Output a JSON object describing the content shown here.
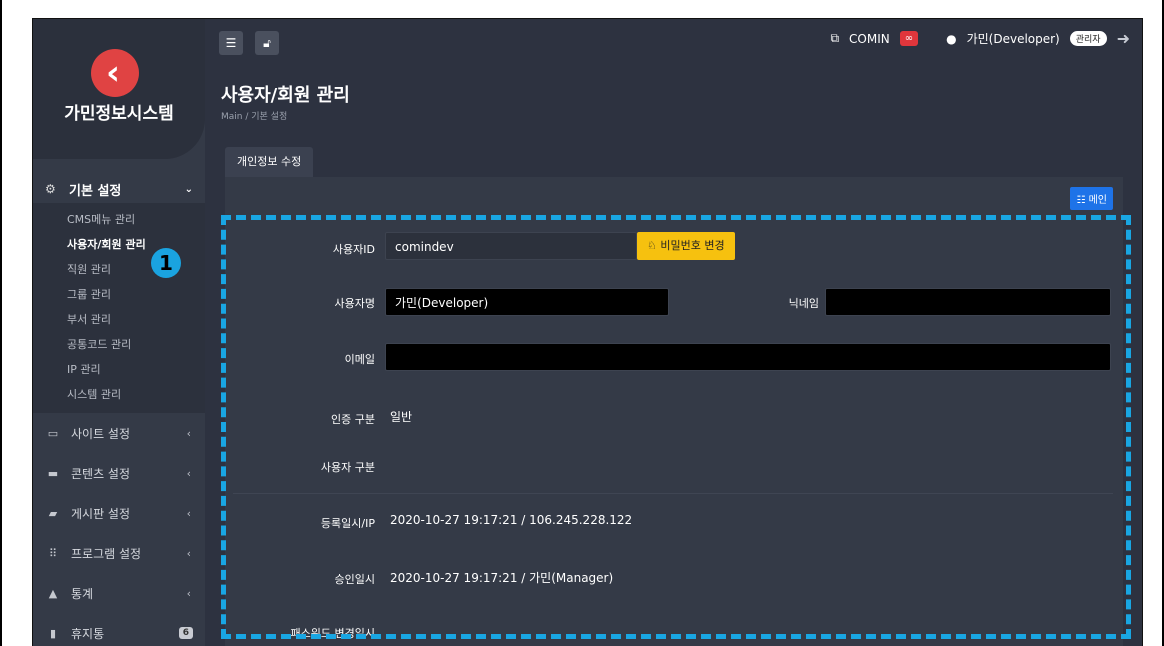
{
  "brand": {
    "name": "가민정보시스템",
    "logo_icon": "chevron-left-logo"
  },
  "sidebar": {
    "group": {
      "label": "기본 설정",
      "items": [
        "CMS메뉴 관리",
        "사용자/회원 관리",
        "직원 관리",
        "그룹 관리",
        "부서 관리",
        "공통코드 관리",
        "IP 관리",
        "시스템 관리"
      ],
      "active_index": 1
    },
    "items": [
      {
        "label": "사이트 설정"
      },
      {
        "label": "콘텐츠 설정"
      },
      {
        "label": "게시판 설정"
      },
      {
        "label": "프로그램 설정"
      },
      {
        "label": "통계"
      },
      {
        "label": "휴지통",
        "badge": "6"
      }
    ],
    "step_marker": "1"
  },
  "topbar": {
    "site_link": "COMIN",
    "user": "가민(Developer)",
    "role": "관리자"
  },
  "page": {
    "title": "사용자/회원 관리",
    "breadcrumb": "Main / 기본 설정",
    "tab": "개인정보 수정",
    "main_button": "메인"
  },
  "form": {
    "userid_label": "사용자ID",
    "userid_value": "comindev",
    "pw_button": "비밀번호 변경",
    "name_label": "사용자명",
    "name_value": "가민(Developer)",
    "nick_label": "닉네임",
    "nick_value": "",
    "email_label": "이메일",
    "email_value": "",
    "auth_label": "인증 구분",
    "auth_value": "일반",
    "usertype_label": "사용자 구분",
    "usertype_value": "",
    "reg_label": "등록일시/IP",
    "reg_value": "2020-10-27 19:17:21 / 106.245.228.122",
    "approve_label": "승인일시",
    "approve_value": "2020-10-27 19:17:21 / 가민(Manager)",
    "pwchange_label": "패스워드 변경일시",
    "pwchange_value": ""
  },
  "colors": {
    "highlight": "#19a6e3",
    "accent": "#1e73e8",
    "warning": "#f6c10f",
    "danger": "#e0363c"
  }
}
